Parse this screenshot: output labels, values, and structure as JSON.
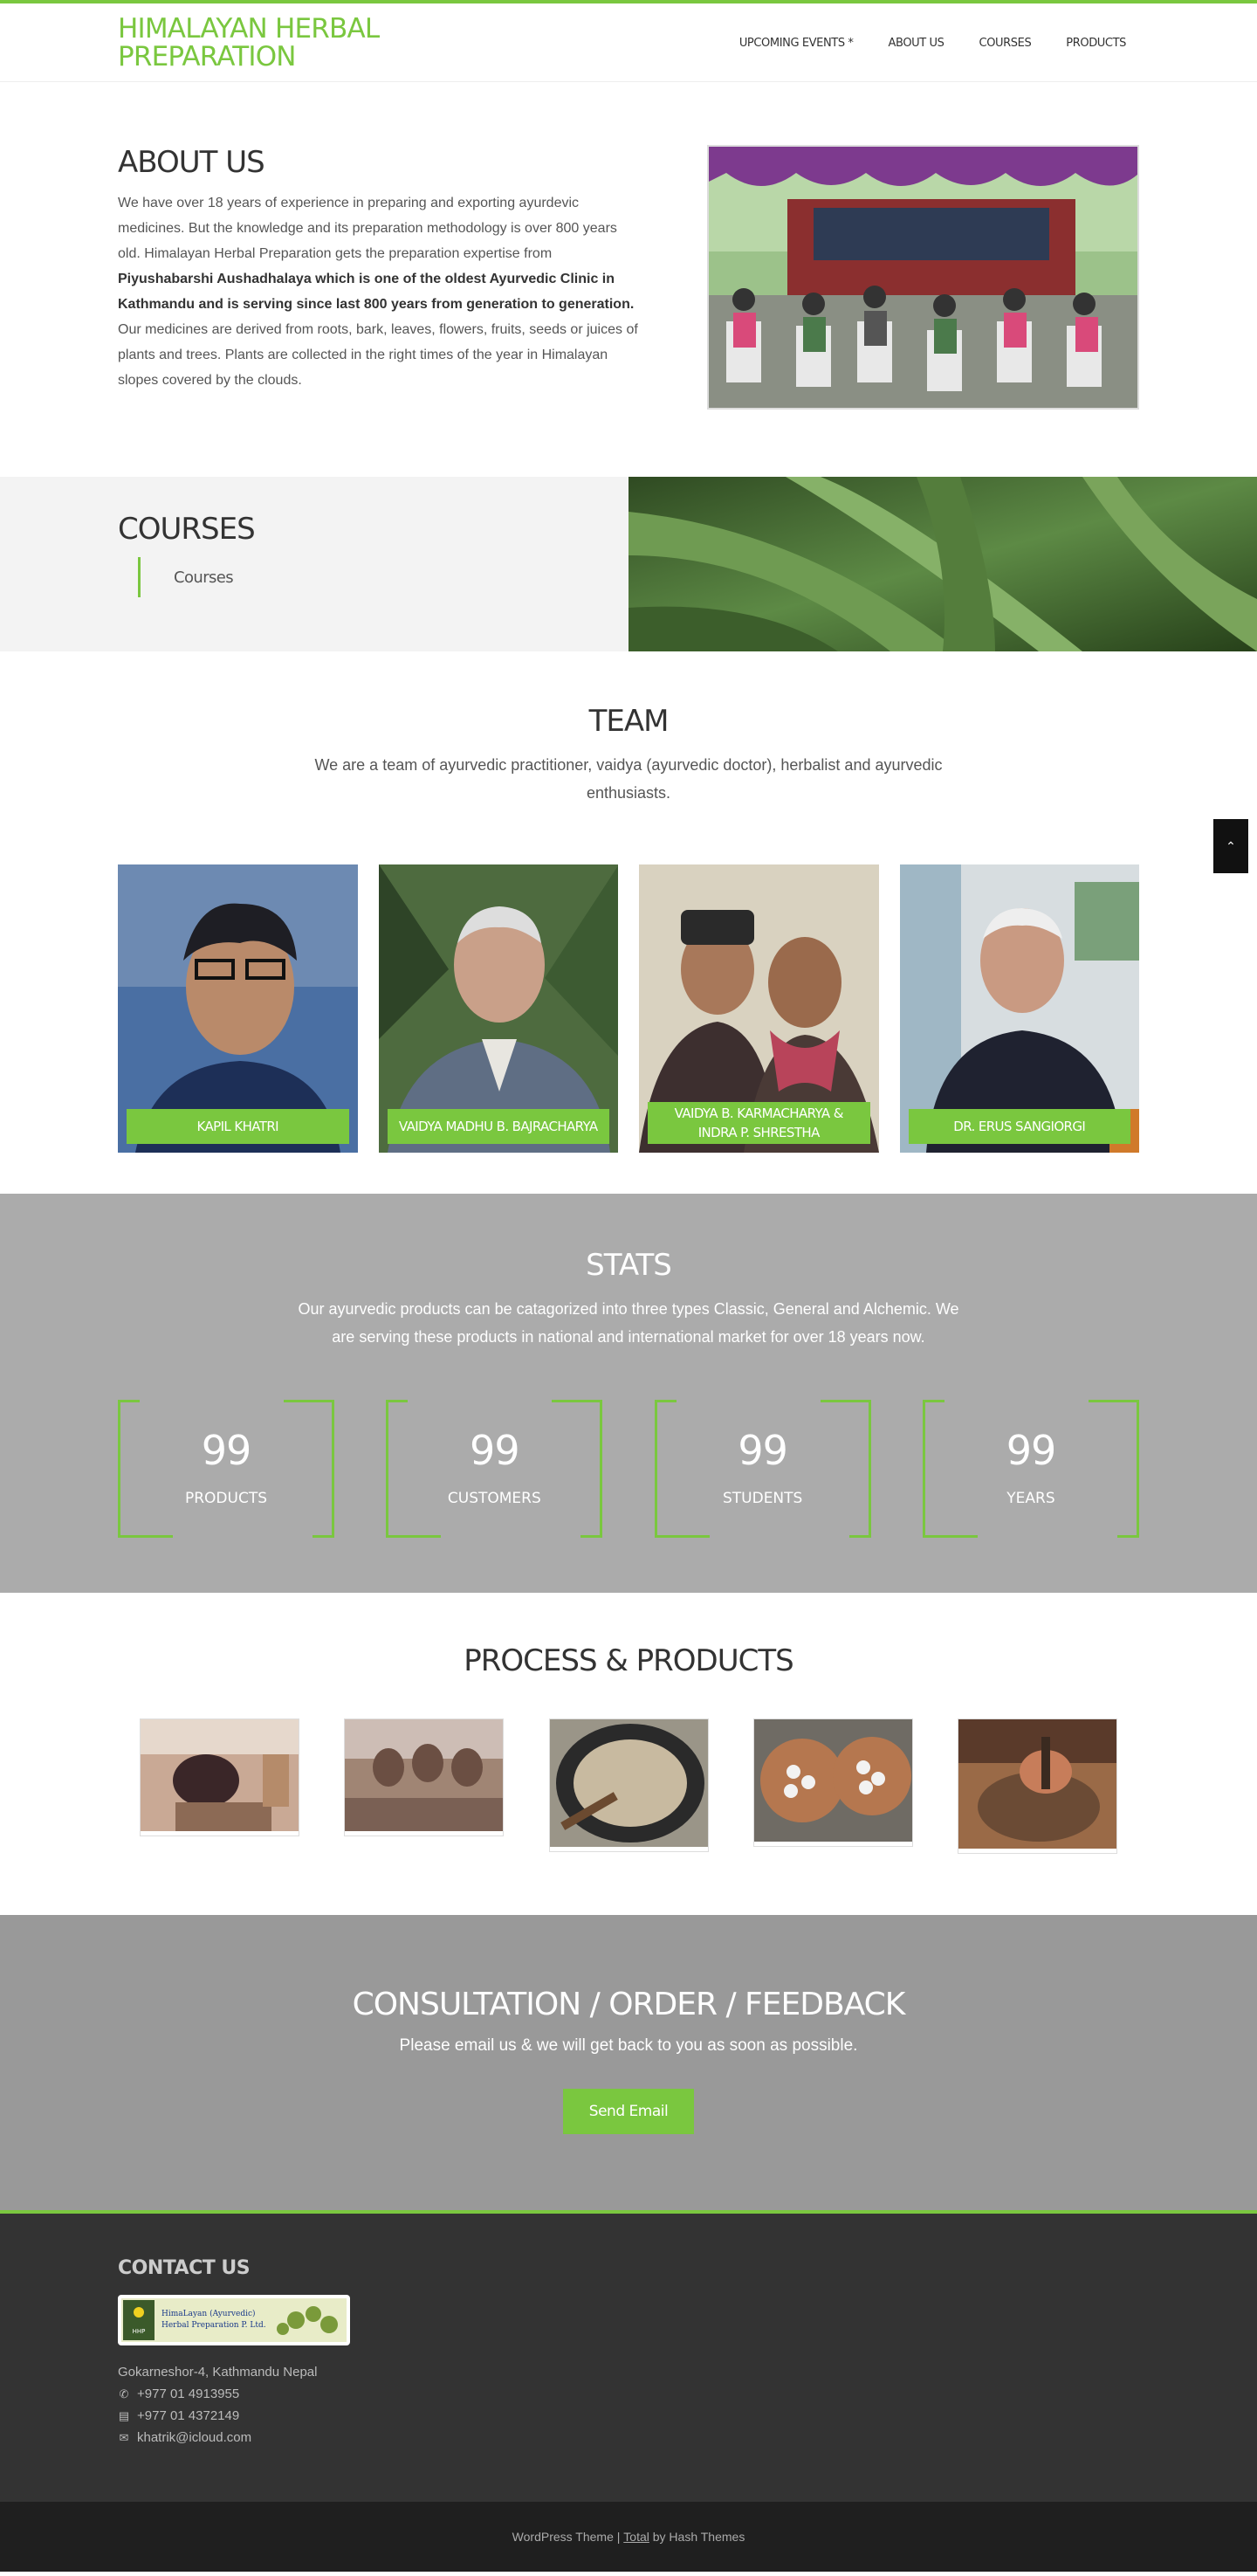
{
  "header": {
    "logo": "HIMALAYAN HERBAL PREPARATION",
    "nav": [
      "UPCOMING EVENTS *",
      "ABOUT US",
      "COURSES",
      "PRODUCTS"
    ]
  },
  "about": {
    "title": "ABOUT US",
    "text_1": "We have over 18 years of experience in preparing and exporting ayurdevic medicines. But the knowledge and its preparation methodology is over 800 years old. Himalayan Herbal Preparation gets the preparation expertise from ",
    "text_bold": "Piyushabarshi Aushadhalaya which is one of the oldest Ayurvedic Clinic in Kathmandu and is serving since last 800 years from generation to generation.",
    "text_2": " Our medicines are derived from roots, bark, leaves, flowers, fruits, seeds or juices of plants and trees. Plants are collected in the right times of the year in Himalayan slopes covered by the clouds."
  },
  "courses": {
    "title": "COURSES",
    "item": "Courses"
  },
  "team": {
    "title": "TEAM",
    "subtitle": "We are a team of ayurvedic practitioner, vaidya (ayurvedic doctor), herbalist and ayurvedic enthusiasts.",
    "members": [
      {
        "name": "KAPIL KHATRI"
      },
      {
        "name": "VAIDYA MADHU B. BAJRACHARYA"
      },
      {
        "name": "VAIDYA B. KARMACHARYA & INDRA P. SHRESTHA"
      },
      {
        "name": "DR. ERUS SANGIORGI"
      }
    ]
  },
  "stats": {
    "title": "STATS",
    "subtitle": "Our ayurvedic products can be catagorized into three types Classic, General and Alchemic. We are serving these products in national and international market for over 18 years now.",
    "counters": [
      {
        "value": "99",
        "label": "PRODUCTS"
      },
      {
        "value": "99",
        "label": "CUSTOMERS"
      },
      {
        "value": "99",
        "label": "STUDENTS"
      },
      {
        "value": "99",
        "label": "YEARS"
      }
    ]
  },
  "process": {
    "title": "PROCESS & PRODUCTS"
  },
  "cta": {
    "title": "CONSULTATION / ORDER / FEEDBACK",
    "text": "Please email us & we will get back to you as soon as possible.",
    "button": "Send Email"
  },
  "footer": {
    "title": "CONTACT US",
    "logo_text_1": "HimaLayan (Ayurvedic)",
    "logo_text_2": "Herbal Preparation P. Ltd.",
    "address": "Gokarneshor-4, Kathmandu Nepal",
    "phone": "+977 01 4913955",
    "fax": "+977 01 4372149",
    "email": "khatrik@icloud.com"
  },
  "bottom": {
    "text_1": "WordPress Theme | ",
    "link": "Total",
    "text_2": " by Hash Themes"
  },
  "colors": {
    "accent": "#7ac73f",
    "stats_bg": "#ababab",
    "cta_bg": "#999999",
    "footer_bg": "#333333"
  }
}
